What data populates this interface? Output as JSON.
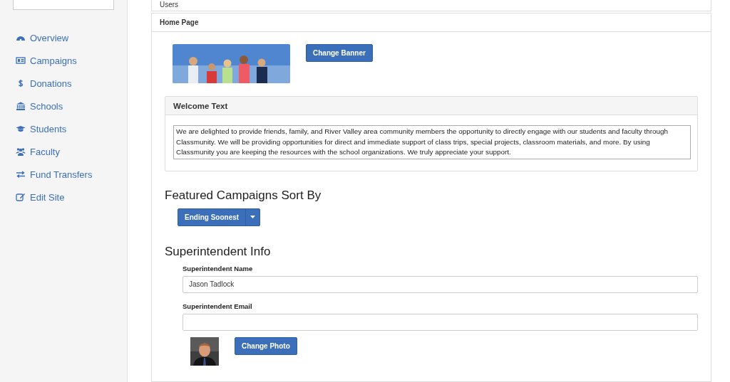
{
  "sidebar": {
    "items": [
      {
        "label": "Overview",
        "kind": "dashboard"
      },
      {
        "label": "Campaigns",
        "kind": "card"
      },
      {
        "label": "Donations",
        "kind": "dollar"
      },
      {
        "label": "Schools",
        "kind": "bank"
      },
      {
        "label": "Students",
        "kind": "cap"
      },
      {
        "label": "Faculty",
        "kind": "users"
      },
      {
        "label": "Fund Transfers",
        "kind": "exchange"
      },
      {
        "label": "Edit Site",
        "kind": "edit"
      }
    ]
  },
  "panels": [
    {
      "title": "Users"
    },
    {
      "title": "Home Page"
    }
  ],
  "banner": {
    "button": "Change Banner"
  },
  "welcome": {
    "title": "Welcome Text",
    "text": "We are delighted to provide friends, family, and River Valley area community members the opportunity to directly engage with our students and faculty through Classmunity. We will be providing opportunities for direct and immediate support of class trips, special projects, classroom materials, and more. By using Classmunity you are keeping the resources with the school organizations. We truly appreciate your support."
  },
  "featured": {
    "heading": "Featured Campaigns Sort By",
    "sort": "Ending Soonest"
  },
  "superintendent": {
    "heading": "Superintendent Info",
    "fields": [
      {
        "label": "Superintendent Name",
        "value": "Jason Tadlock"
      },
      {
        "label": "Superintendent Email"
      }
    ],
    "button": "Change Photo"
  }
}
